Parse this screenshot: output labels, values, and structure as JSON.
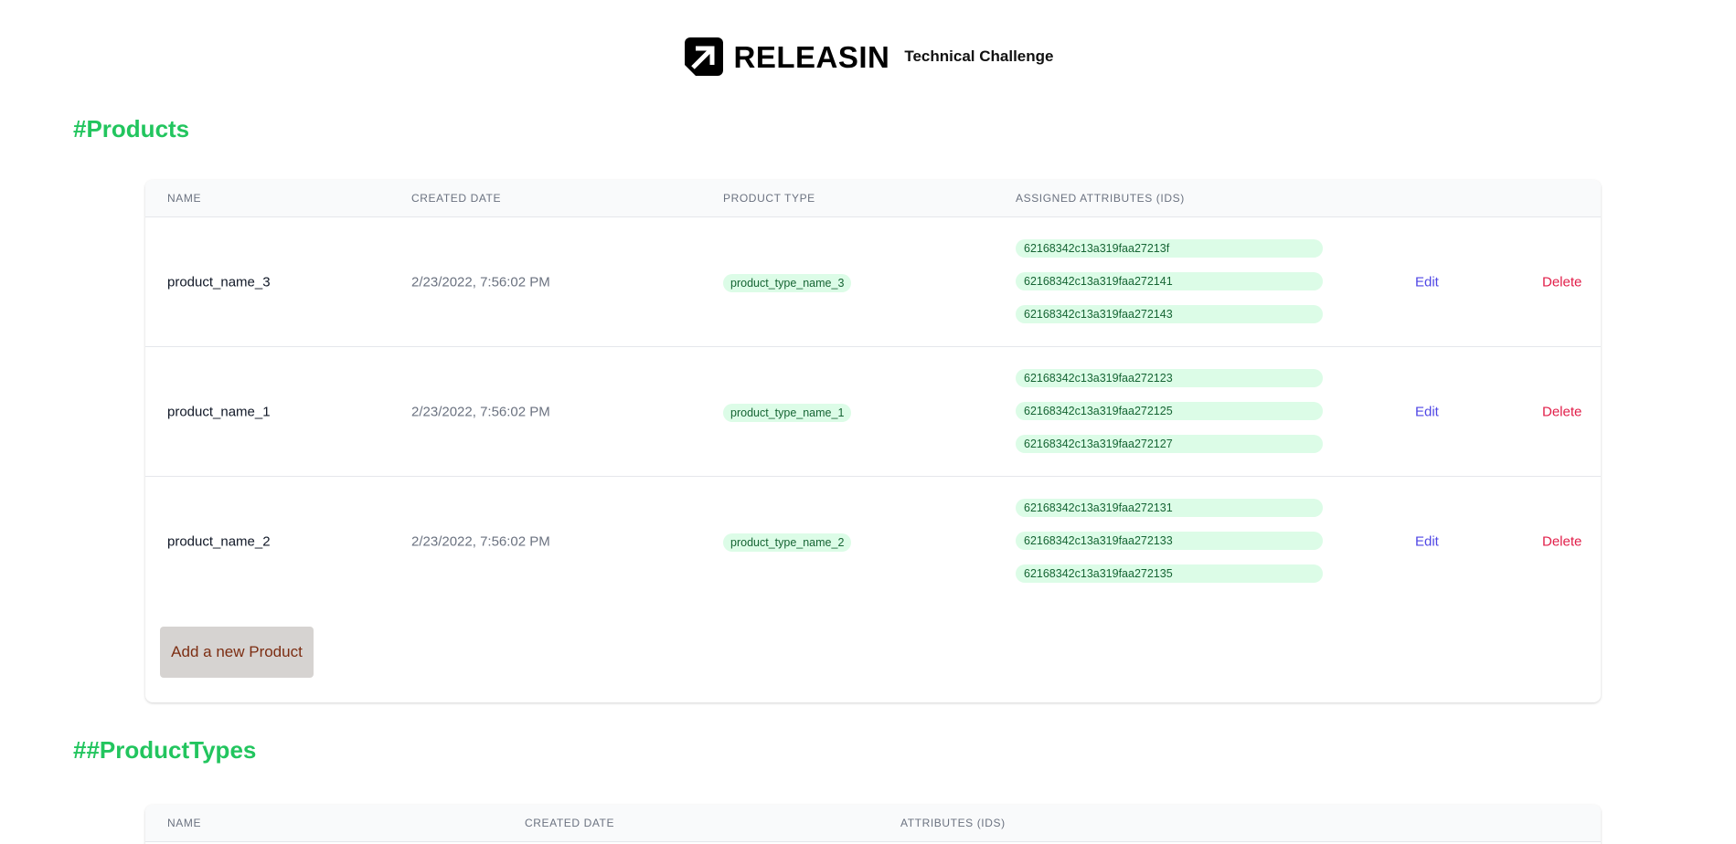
{
  "header": {
    "brand": "RELEASIN",
    "subtitle": "Technical Challenge",
    "logo_icon": "releasin-arrow-logo-icon"
  },
  "products": {
    "title": "#Products",
    "columns": [
      "NAME",
      "CREATED DATE",
      "PRODUCT TYPE",
      "ASSIGNED ATTRIBUTES (IDS)"
    ],
    "rows": [
      {
        "name": "product_name_3",
        "created": "2/23/2022, 7:56:02 PM",
        "type": "product_type_name_3",
        "attributes": [
          "62168342c13a319faa27213f",
          "62168342c13a319faa272141",
          "62168342c13a319faa272143"
        ],
        "edit": "Edit",
        "delete": "Delete"
      },
      {
        "name": "product_name_1",
        "created": "2/23/2022, 7:56:02 PM",
        "type": "product_type_name_1",
        "attributes": [
          "62168342c13a319faa272123",
          "62168342c13a319faa272125",
          "62168342c13a319faa272127"
        ],
        "edit": "Edit",
        "delete": "Delete"
      },
      {
        "name": "product_name_2",
        "created": "2/23/2022, 7:56:02 PM",
        "type": "product_type_name_2",
        "attributes": [
          "62168342c13a319faa272131",
          "62168342c13a319faa272133",
          "62168342c13a319faa272135"
        ],
        "edit": "Edit",
        "delete": "Delete"
      }
    ],
    "add_button": "Add a new Product"
  },
  "product_types": {
    "title": "##ProductTypes",
    "columns": [
      "NAME",
      "CREATED DATE",
      "ATTRIBUTES (IDS)"
    ]
  },
  "colors": {
    "accent_green": "#22c55e",
    "badge_bg": "#dcfce7",
    "badge_text": "#166534",
    "edit": "#4f46e5",
    "delete": "#e11d48",
    "add_button_bg": "#d6d3d1",
    "add_button_text": "#7c2d12"
  }
}
